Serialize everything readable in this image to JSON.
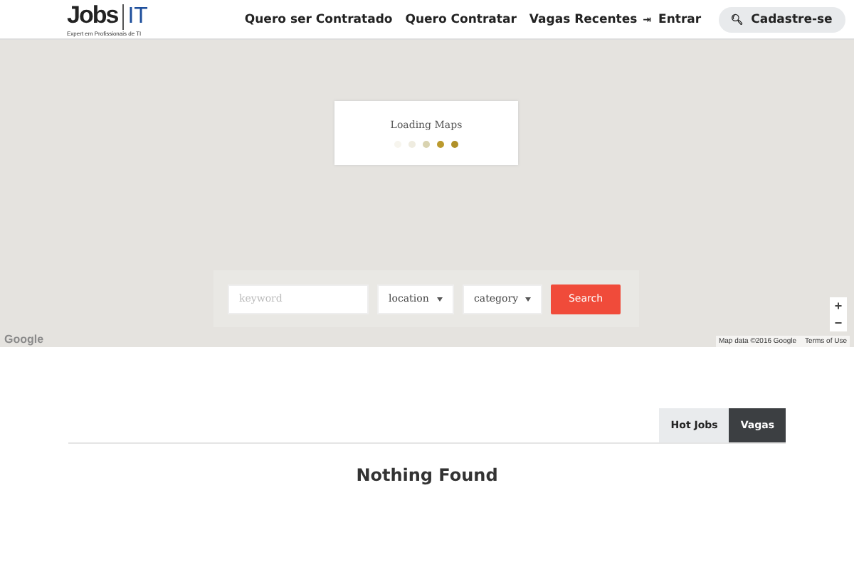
{
  "header": {
    "logo": {
      "name": "Jobs",
      "accent": "IT",
      "tagline": "Expert em Profissionais de TI"
    },
    "nav": [
      "Quero ser Contratado",
      "Quero Contratar",
      "Vagas Recentes"
    ],
    "login": {
      "icon": "⇥",
      "label": "Entrar"
    },
    "signup": {
      "icon": "🔍︎",
      "label": "Cadastre-se"
    }
  },
  "map": {
    "loading": {
      "text": "Loading Maps",
      "dots": [
        {
          "color": "#f7f5ee"
        },
        {
          "color": "#efece0"
        },
        {
          "color": "#d9d3b0"
        },
        {
          "color": "#bb9a2e"
        },
        {
          "color": "#b09028"
        }
      ]
    },
    "search": {
      "keyword_placeholder": "keyword",
      "location": "location",
      "category": "category",
      "button": "Search"
    },
    "zoom": [
      "+",
      "−"
    ],
    "watermark": "Google",
    "attribution": "Map data ©2016 Google",
    "terms": "Terms of Use"
  },
  "tabs": [
    {
      "label": "Hot Jobs",
      "selected": false
    },
    {
      "label": "Vagas",
      "selected": true
    }
  ],
  "empty_message": "Nothing Found"
}
